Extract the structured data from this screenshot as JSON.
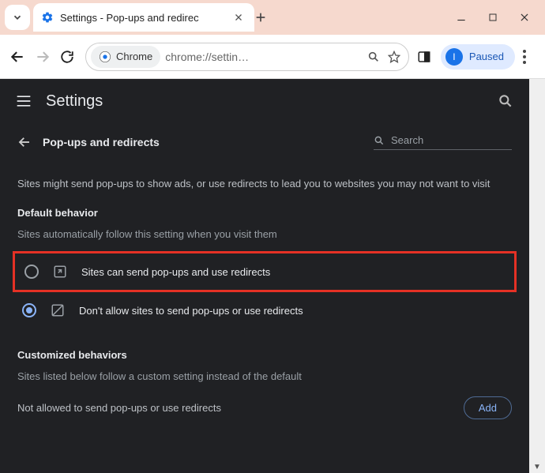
{
  "window": {
    "tab_title": "Settings - Pop-ups and redirec",
    "paused_label": "Paused",
    "paused_initial": "I"
  },
  "omnibox": {
    "chip_label": "Chrome",
    "url": "chrome://settin…"
  },
  "header": {
    "title": "Settings"
  },
  "page": {
    "title": "Pop-ups and redirects",
    "search_placeholder": "Search",
    "intro": "Sites might send pop-ups to show ads, or use redirects to lead you to websites you may not want to visit",
    "default_behavior_title": "Default behavior",
    "default_behavior_sub": "Sites automatically follow this setting when you visit them",
    "option_allow": "Sites can send pop-ups and use redirects",
    "option_block": "Don't allow sites to send pop-ups or use redirects",
    "custom_title": "Customized behaviors",
    "custom_sub": "Sites listed below follow a custom setting instead of the default",
    "not_allowed_label": "Not allowed to send pop-ups or use redirects",
    "add_label": "Add"
  }
}
